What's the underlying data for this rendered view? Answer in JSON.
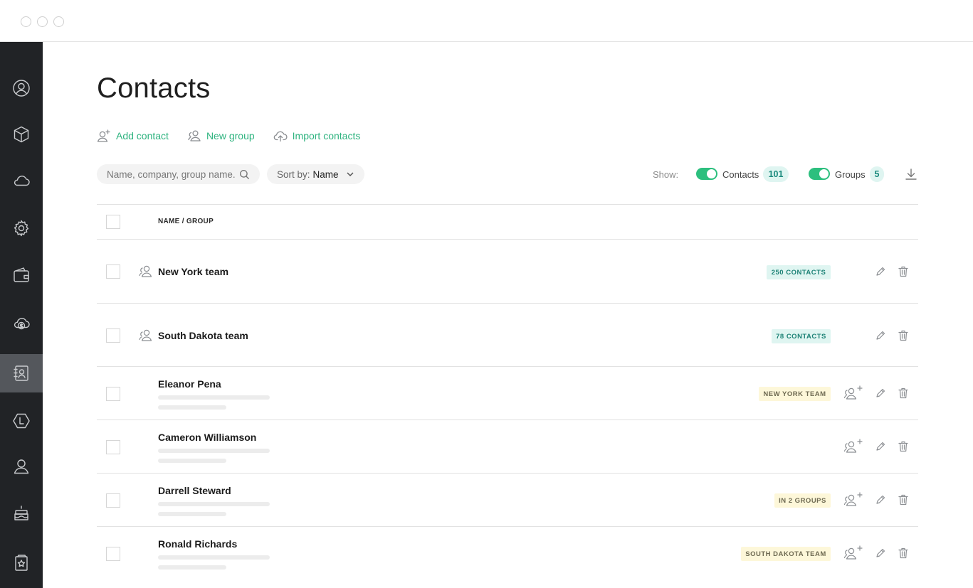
{
  "app": {
    "page_title": "Contacts"
  },
  "sidebar": {
    "items": [
      {
        "icon": "user-circle-icon",
        "active": false
      },
      {
        "icon": "box-icon",
        "active": false
      },
      {
        "icon": "cloud-icon",
        "active": false
      },
      {
        "icon": "gear-icon",
        "active": false
      },
      {
        "icon": "wallet-icon",
        "active": false
      },
      {
        "icon": "cloud-dollar-icon",
        "active": false
      },
      {
        "icon": "contacts-book-icon",
        "active": true
      },
      {
        "icon": "hexagon-l-icon",
        "active": false
      },
      {
        "icon": "person-icon",
        "active": false
      },
      {
        "icon": "cake-icon",
        "active": false
      },
      {
        "icon": "star-card-icon",
        "active": false
      }
    ]
  },
  "actions": {
    "add_contact": "Add contact",
    "new_group": "New group",
    "import_contacts": "Import contacts"
  },
  "search": {
    "placeholder": "Name, company, group name..."
  },
  "sort": {
    "label": "Sort by:",
    "value": "Name"
  },
  "filters": {
    "show_label": "Show:",
    "contacts_label": "Contacts",
    "contacts_count": "101",
    "contacts_on": true,
    "groups_label": "Groups",
    "groups_count": "5",
    "groups_on": true
  },
  "table": {
    "header": "NAME / GROUP",
    "rows": [
      {
        "type": "group",
        "name": "New York team",
        "tag": "250 CONTACTS",
        "tag_style": "teal"
      },
      {
        "type": "group",
        "name": "South Dakota team",
        "tag": "78 CONTACTS",
        "tag_style": "teal"
      },
      {
        "type": "contact",
        "name": "Eleanor Pena",
        "tag": "NEW YORK TEAM",
        "tag_style": "yellow"
      },
      {
        "type": "contact",
        "name": "Cameron Williamson",
        "tag": "",
        "tag_style": ""
      },
      {
        "type": "contact",
        "name": "Darrell Steward",
        "tag": "IN 2 GROUPS",
        "tag_style": "yellow"
      },
      {
        "type": "contact",
        "name": "Ronald Richards",
        "tag": "SOUTH DAKOTA TEAM",
        "tag_style": "yellow"
      }
    ]
  },
  "colors": {
    "accent_green": "#2eb37f",
    "toggle_green": "#2cbf7e",
    "sidebar_bg": "#212326",
    "sidebar_active": "#54575c",
    "teal_tag_bg": "#dff5f1",
    "yellow_tag_bg": "#fdf7d9"
  }
}
